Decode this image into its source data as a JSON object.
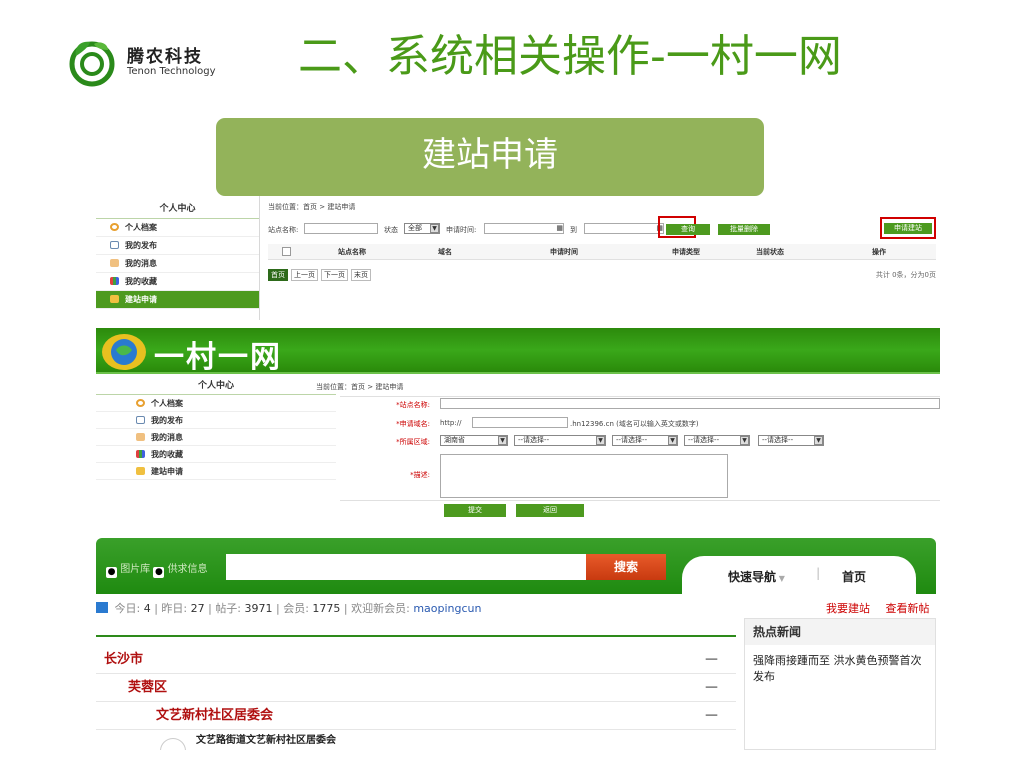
{
  "logo": {
    "cn": "腾农科技",
    "en": "Tenon Technology"
  },
  "slide_title": "二、系统相关操作-一村一网",
  "banner": "建站申请",
  "screen1": {
    "sidebar_title": "个人中心",
    "sidebar_items": [
      "个人档案",
      "我的发布",
      "我的消息",
      "我的收藏",
      "建站申请"
    ],
    "breadcrumb_label": "当前位置：",
    "breadcrumb_home": "首页",
    "breadcrumb_sep": " > ",
    "breadcrumb_current": "建站申请",
    "filter_site_name": "站点名称:",
    "filter_status": "状态",
    "filter_status_value": "全部",
    "filter_apply_time": "申请时间:",
    "filter_to": "到",
    "query_btn": "查询",
    "batch_delete_btn": "批量删除",
    "apply_btn": "申请建站",
    "columns": [
      "站点名称",
      "域名",
      "申请时间",
      "申请类型",
      "当前状态",
      "操作"
    ],
    "pager": [
      "首页",
      "上一页",
      "下一页",
      "末页"
    ],
    "total": "共计 0条，分为0页"
  },
  "screen2": {
    "title": "一村一网",
    "sidebar_title": "个人中心",
    "sidebar_items": [
      "个人档案",
      "我的发布",
      "我的消息",
      "我的收藏",
      "建站申请"
    ],
    "breadcrumb_label": "当前位置：",
    "breadcrumb_home": "首页",
    "breadcrumb_sep": " > ",
    "breadcrumb_current": "建站申请",
    "label_site_name": "*站点名称:",
    "label_domain": "*申请域名:",
    "domain_prefix": "http://",
    "domain_suffix": ".hn12396.cn (域名可以输入英文或数字)",
    "label_region": "*所属区域:",
    "region_province": "湖南省",
    "region_placeholder": "--请选择--",
    "label_desc": "*描述:",
    "submit_btn": "提交",
    "back_btn": "返回"
  },
  "screen3": {
    "radio1": "图片库",
    "radio2": "供求信息",
    "search_btn": "搜索",
    "nav_quick": "快速导航",
    "nav_home": "首页",
    "stats": [
      {
        "label": "今日: ",
        "value": "4"
      },
      {
        "label": "昨日: ",
        "value": "27"
      },
      {
        "label": "帖子: ",
        "value": "3971"
      },
      {
        "label": "会员: ",
        "value": "1775"
      }
    ],
    "welcome_label": "欢迎新会员: ",
    "welcome_user": "maopingcun",
    "link_build": "我要建站",
    "link_new_posts": "查看新帖",
    "hot_news_title": "热点新闻",
    "hot_news_item": "强降雨接踵而至 洪水黄色预警首次发布",
    "rows": [
      "长沙市",
      "芙蓉区",
      "文艺新村社区居委会"
    ],
    "partial_row": "文艺路街道文艺新村社区居委会"
  }
}
